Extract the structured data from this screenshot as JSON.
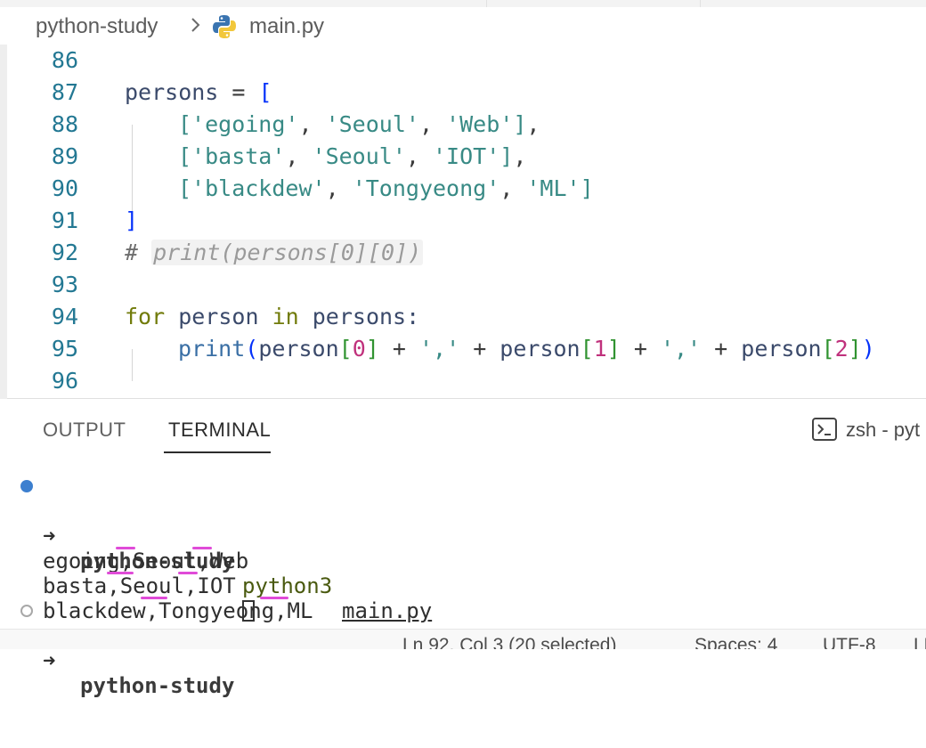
{
  "breadcrumb": {
    "folder": "python-study",
    "file": "main.py"
  },
  "editor": {
    "lines": [
      {
        "num": "86"
      },
      {
        "num": "87",
        "tokens": [
          [
            "persons",
            "var"
          ],
          [
            " = ",
            "plain"
          ],
          [
            "[",
            "br1"
          ]
        ]
      },
      {
        "num": "88",
        "tokens": [
          [
            "['egoing'",
            "str"
          ],
          [
            ", ",
            "plain"
          ],
          [
            "'Seoul'",
            "str"
          ],
          [
            ", ",
            "plain"
          ],
          [
            "'Web'",
            "str"
          ],
          [
            "]",
            "str"
          ],
          [
            ",",
            "plain"
          ]
        ]
      },
      {
        "num": "89",
        "tokens": [
          [
            "['basta'",
            "str"
          ],
          [
            ", ",
            "plain"
          ],
          [
            "'Seoul'",
            "str"
          ],
          [
            ", ",
            "plain"
          ],
          [
            "'IOT'",
            "str"
          ],
          [
            "]",
            "str"
          ],
          [
            ",",
            "plain"
          ]
        ]
      },
      {
        "num": "90",
        "tokens": [
          [
            "['blackdew'",
            "str"
          ],
          [
            ", ",
            "plain"
          ],
          [
            "'Tongyeong'",
            "str"
          ],
          [
            ", ",
            "plain"
          ],
          [
            "'ML'",
            "str"
          ],
          [
            "]",
            "str"
          ]
        ]
      },
      {
        "num": "91",
        "tokens": [
          [
            "]",
            "br1"
          ]
        ]
      },
      {
        "num": "92",
        "tokens": [
          [
            "# ",
            "cmt"
          ],
          [
            "print(persons[0][0])",
            "inlay"
          ]
        ]
      },
      {
        "num": "93"
      },
      {
        "num": "94",
        "tokens": [
          [
            "for",
            "kw"
          ],
          [
            " person ",
            "var"
          ],
          [
            "in",
            "kw"
          ],
          [
            " persons:",
            "var"
          ]
        ]
      },
      {
        "num": "95",
        "tokens": [
          [
            "print",
            "fn"
          ],
          [
            "(",
            "br1"
          ],
          [
            "person",
            "var"
          ],
          [
            "[",
            "br2"
          ],
          [
            "0",
            "num"
          ],
          [
            "]",
            "br2"
          ],
          [
            " + ",
            "plain"
          ],
          [
            "','",
            "str"
          ],
          [
            " + ",
            "plain"
          ],
          [
            "person",
            "var"
          ],
          [
            "[",
            "br2"
          ],
          [
            "1",
            "num"
          ],
          [
            "]",
            "br2"
          ],
          [
            " + ",
            "plain"
          ],
          [
            "','",
            "str"
          ],
          [
            " + ",
            "plain"
          ],
          [
            "person",
            "var"
          ],
          [
            "[",
            "br2"
          ],
          [
            "2",
            "num"
          ],
          [
            "]",
            "br2"
          ],
          [
            ")",
            "br1"
          ]
        ]
      },
      {
        "num": "96"
      }
    ]
  },
  "panel": {
    "tabs": [
      "OUTPUT",
      "TERMINAL"
    ],
    "active_tab": "TERMINAL",
    "terminal_name": "zsh - pyt"
  },
  "terminal": {
    "arrow": "➜",
    "prompt_dir": "python-study",
    "command": "python3",
    "argument": "main.py",
    "output": [
      "egoing,Seoul,Web",
      "basta,Seoul,IOT",
      "blackdew,Tongyeong,ML"
    ]
  },
  "statusbar": {
    "position": "Ln 92, Col 3 (20 selected)",
    "spaces": "Spaces: 4",
    "encoding": "UTF-8",
    "eol": "LF"
  },
  "colors": {
    "string": "#388a85",
    "keyword": "#717b0a",
    "function": "#3a6fa5",
    "bracket_outer": "#0431fa",
    "bracket_inner": "#319331",
    "number": "#c0317c",
    "line_number": "#237893",
    "annotation_mark": "#e04bd8",
    "terminal_dot": "#3c7fcf"
  }
}
